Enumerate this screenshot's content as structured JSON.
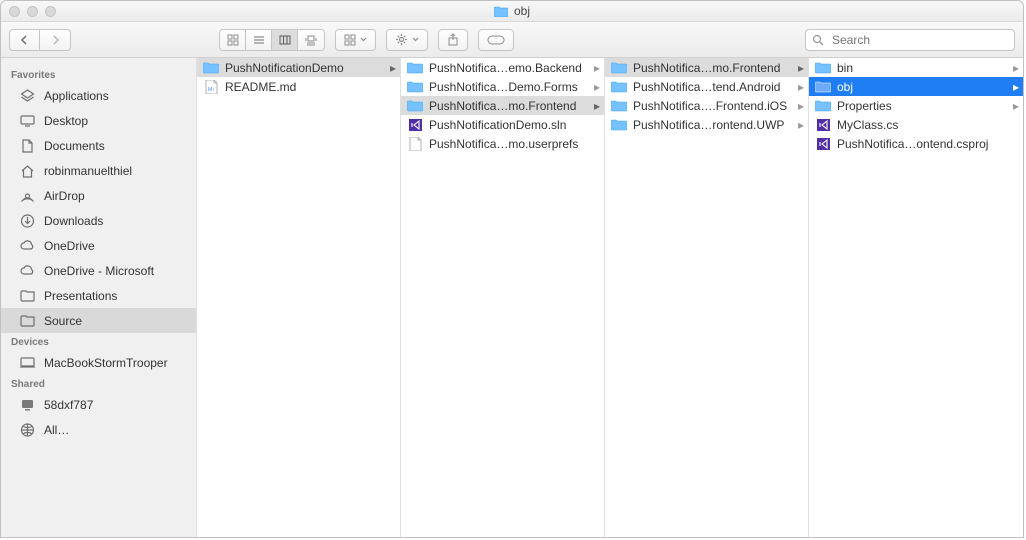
{
  "title": "obj",
  "search_placeholder": "Search",
  "sidebar": {
    "groups": [
      {
        "label": "Favorites",
        "items": [
          {
            "icon": "apps",
            "label": "Applications"
          },
          {
            "icon": "desktop",
            "label": "Desktop"
          },
          {
            "icon": "documents",
            "label": "Documents"
          },
          {
            "icon": "home",
            "label": "robinmanuelthiel"
          },
          {
            "icon": "airdrop",
            "label": "AirDrop"
          },
          {
            "icon": "downloads",
            "label": "Downloads"
          },
          {
            "icon": "onedrive",
            "label": "OneDrive"
          },
          {
            "icon": "onedrive",
            "label": "OneDrive - Microsoft"
          },
          {
            "icon": "folder-side",
            "label": "Presentations"
          },
          {
            "icon": "folder-side",
            "label": "Source",
            "selected": true
          }
        ]
      },
      {
        "label": "Devices",
        "items": [
          {
            "icon": "mac",
            "label": "MacBookStormTrooper"
          }
        ]
      },
      {
        "label": "Shared",
        "items": [
          {
            "icon": "pc",
            "label": "58dxf787"
          },
          {
            "icon": "globe",
            "label": "All…"
          }
        ]
      }
    ]
  },
  "columns": [
    {
      "items": [
        {
          "kind": "folder",
          "label": "PushNotificationDemo",
          "arrow": true,
          "sel": "gray"
        },
        {
          "kind": "file-md",
          "label": "README.md"
        }
      ]
    },
    {
      "items": [
        {
          "kind": "folder",
          "label": "PushNotifica…emo.Backend",
          "arrow": true
        },
        {
          "kind": "folder",
          "label": "PushNotifica…Demo.Forms",
          "arrow": true
        },
        {
          "kind": "folder",
          "label": "PushNotifica…mo.Frontend",
          "arrow": true,
          "sel": "gray"
        },
        {
          "kind": "file-vs",
          "label": "PushNotificationDemo.sln"
        },
        {
          "kind": "file",
          "label": "PushNotifica…mo.userprefs"
        }
      ]
    },
    {
      "items": [
        {
          "kind": "folder",
          "label": "PushNotifica…mo.Frontend",
          "arrow": true,
          "sel": "gray"
        },
        {
          "kind": "folder",
          "label": "PushNotifica…tend.Android",
          "arrow": true
        },
        {
          "kind": "folder",
          "label": "PushNotifica….Frontend.iOS",
          "arrow": true
        },
        {
          "kind": "folder",
          "label": "PushNotifica…rontend.UWP",
          "arrow": true
        }
      ]
    },
    {
      "items": [
        {
          "kind": "folder",
          "label": "bin",
          "arrow": true
        },
        {
          "kind": "folder",
          "label": "obj",
          "arrow": true,
          "sel": "blue"
        },
        {
          "kind": "folder",
          "label": "Properties",
          "arrow": true
        },
        {
          "kind": "file-vs",
          "label": "MyClass.cs"
        },
        {
          "kind": "file-vs",
          "label": "PushNotifica…ontend.csproj"
        }
      ]
    }
  ]
}
